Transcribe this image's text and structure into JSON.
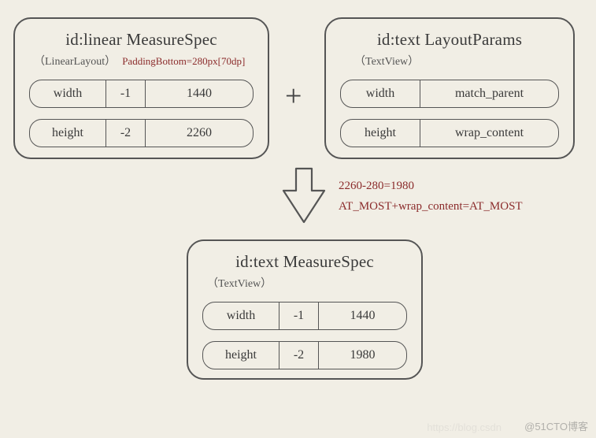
{
  "box_linear": {
    "title": "id:linear MeasureSpec",
    "subtitle": "（LinearLayout）",
    "padding_note": "PaddingBottom=280px[70dp]",
    "rows": [
      {
        "label": "width",
        "mode": "-1",
        "value": "1440"
      },
      {
        "label": "height",
        "mode": "-2",
        "value": "2260"
      }
    ]
  },
  "box_params": {
    "title": "id:text   LayoutParams",
    "subtitle": "（TextView）",
    "rows": [
      {
        "label": "width",
        "value": "match_parent"
      },
      {
        "label": "height",
        "value": "wrap_content"
      }
    ]
  },
  "box_result": {
    "title": "id:text  MeasureSpec",
    "subtitle": "（TextView）",
    "rows": [
      {
        "label": "width",
        "mode": "-1",
        "value": "1440"
      },
      {
        "label": "height",
        "mode": "-2",
        "value": "1980"
      }
    ]
  },
  "plus": "+",
  "annot": {
    "line1": "2260-280=1980",
    "line2": "AT_MOST+wrap_content=AT_MOST"
  },
  "watermark_main": "@51CTO博客",
  "watermark_faint": "https://blog.csdn"
}
